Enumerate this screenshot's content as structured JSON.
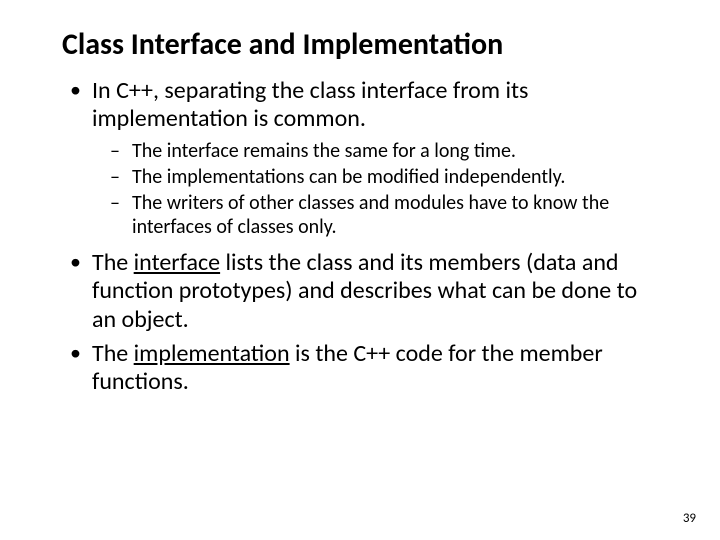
{
  "title": "Class Interface and Implementation",
  "bullets": {
    "b1": "In C++, separating the class interface from its implementation is common.",
    "b1_sub": {
      "s1": "The interface remains the same for a long time.",
      "s2": "The implementations can be modified independently.",
      "s3": "The writers of other classes and modules have to know the interfaces of classes only."
    },
    "b2_pre": "The ",
    "b2_u": "interface",
    "b2_post": " lists the class and its members (data and function prototypes) and describes what can be done to an object.",
    "b3_pre": "The ",
    "b3_u": "implementation",
    "b3_post": " is the C++ code for the member functions."
  },
  "page_number": "39"
}
